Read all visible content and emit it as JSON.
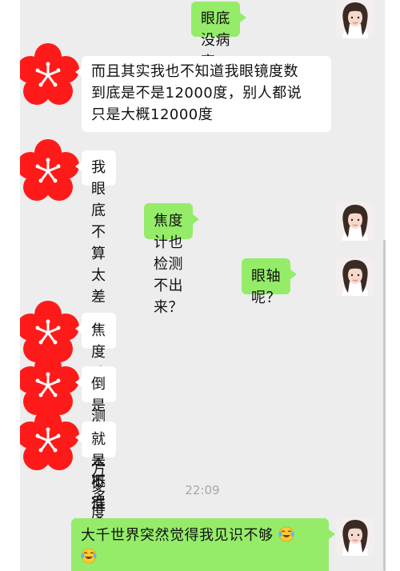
{
  "messages": [
    {
      "side": "out",
      "text": "眼底没病变吗？"
    },
    {
      "side": "in",
      "lines": [
        "而且其实我也不知道我眼镜度数",
        "到底是不是12000度，别人都说",
        "只是大概12000度"
      ]
    },
    {
      "side": "in",
      "text": "我眼底不算太差"
    },
    {
      "side": "out",
      "text": "焦度计也检测不出来？"
    },
    {
      "side": "out",
      "text": "眼轴呢？"
    },
    {
      "side": "in",
      "text": "焦度计能测出大概得"
    },
    {
      "side": "in",
      "text": "倒是有一万多度"
    },
    {
      "side": "in",
      "text": "就是不准"
    },
    {
      "side": "out",
      "lines": [
        "大千世界突然觉得我见识不够",
        ""
      ]
    }
  ],
  "timestamp": "22:09",
  "icons": {
    "incoming_avatar": "red-plum-blossom-icon",
    "outgoing_avatar": "girl-portrait-icon",
    "emoji": "laughing-crying-emoji-icon"
  },
  "colors": {
    "background": "#ededed",
    "incoming_bubble": "#ffffff",
    "outgoing_bubble": "#95ec69",
    "blossom": "#ff1a1a"
  }
}
